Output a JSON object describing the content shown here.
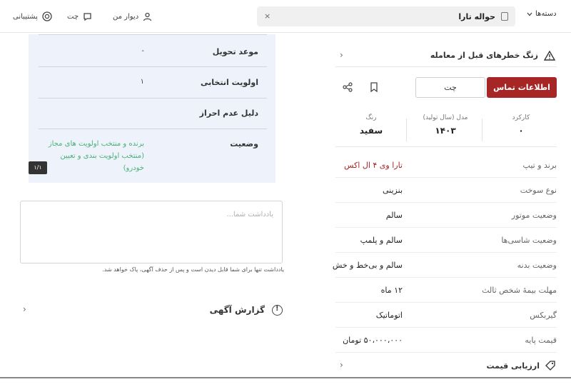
{
  "topbar": {
    "categories_label": "دسته‌ها",
    "search_city": "حواله تارا",
    "search_clear": "×",
    "my_divar": "دیوار من",
    "chat": "چت",
    "support": "پشتیبانی"
  },
  "info_table": {
    "rows": [
      {
        "label": "موعد تحویل",
        "value": "-"
      },
      {
        "label": "اولویت انتخابی",
        "value": "۱"
      },
      {
        "label": "دلیل عدم احراز",
        "value": ""
      },
      {
        "label": "وضعیت",
        "value": "برنده و منتخب اولویت های مجاز (منتخب اولویت بندی و تعیین خودرو)"
      }
    ],
    "badge": "۱/۱"
  },
  "note": {
    "placeholder": "یادداشت شما...",
    "hint": "یادداشت تنها برای شما قابل دیدن است و پس از حذف آگهی، پاک خواهد شد."
  },
  "report": {
    "label": "گزارش آگهی"
  },
  "warning": {
    "text": "زنگ خطرهای قبل از معامله"
  },
  "actions": {
    "contact": "اطلاعات تماس",
    "chat": "چت"
  },
  "stats": [
    {
      "label": "کارکرد",
      "value": "۰"
    },
    {
      "label": "مدل (سال تولید)",
      "value": "۱۴۰۳"
    },
    {
      "label": "رنگ",
      "value": "سفید"
    }
  ],
  "attributes": [
    {
      "label": "برند و تیپ",
      "value": "تارا وی ۴ ال اکس",
      "link": true
    },
    {
      "label": "نوع سوخت",
      "value": "بنزینی"
    },
    {
      "label": "وضعیت موتور",
      "value": "سالم"
    },
    {
      "label": "وضعیت شاسی‌ها",
      "value": "سالم و پلمپ"
    },
    {
      "label": "وضعیت بدنه",
      "value": "سالم و بی‌خط و خش"
    },
    {
      "label": "مهلت بیمهٔ شخص ثالث",
      "value": "۱۲ ماه"
    },
    {
      "label": "گیربکس",
      "value": "اتوماتیک"
    },
    {
      "label": "قیمت پایه",
      "value": "۵۰،۰۰۰،۰۰۰ تومان"
    }
  ],
  "price_eval": {
    "label": "ارزیابی قیمت"
  },
  "colors": {
    "primary": "#a62626",
    "success": "#4caf7a",
    "card_bg": "#eef3fb"
  }
}
